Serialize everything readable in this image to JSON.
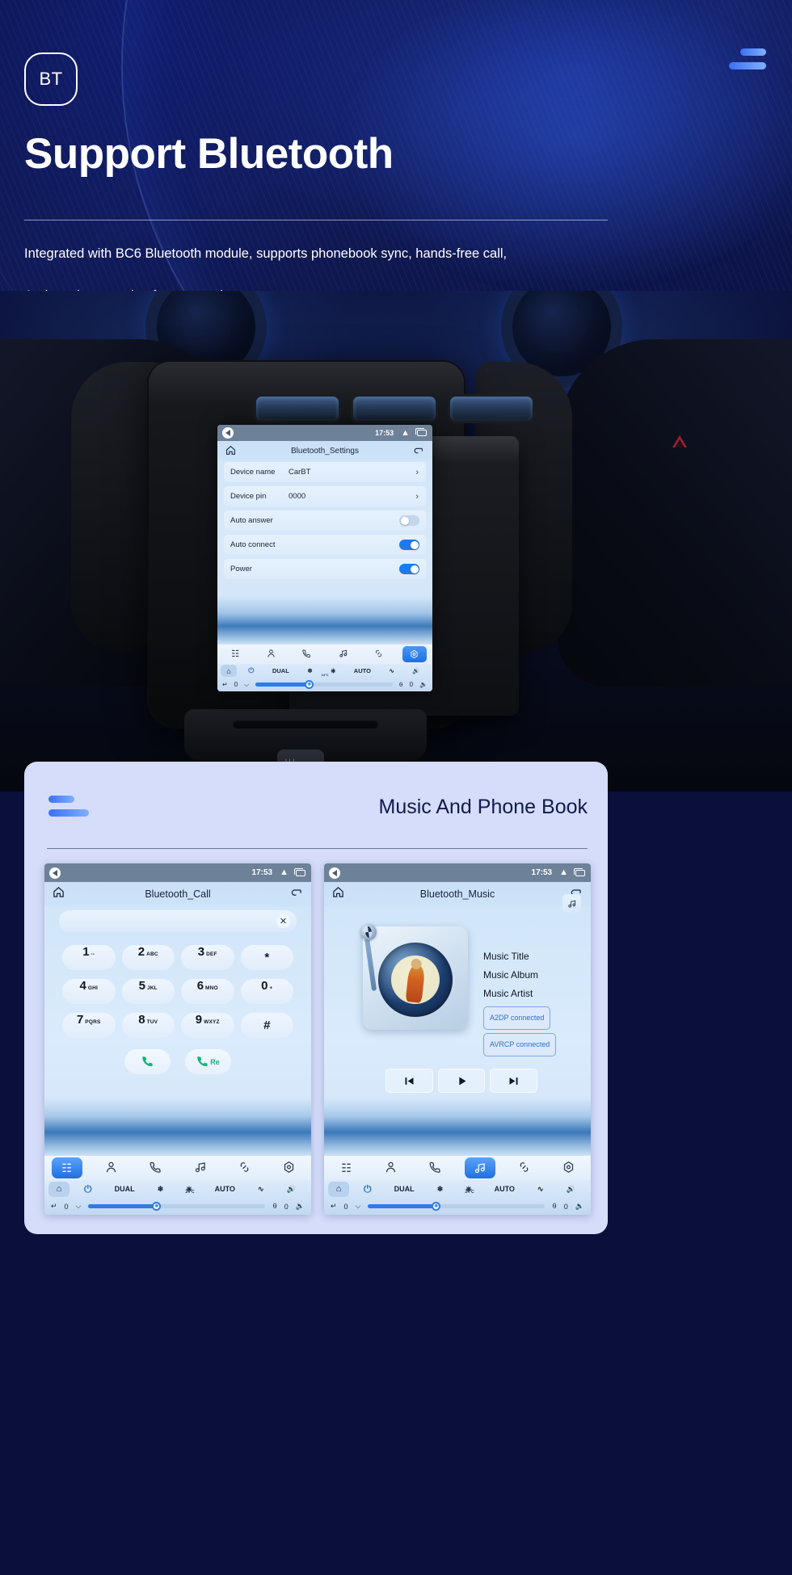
{
  "hero": {
    "badge": "BT",
    "title": "Support Bluetooth",
    "subtitle_line1": "Integrated with BC6 Bluetooth module, supports phonebook sync, hands-free call,",
    "subtitle_line2": "And music streaming from your phone.",
    "accent_color": "#3b6ff5",
    "background_color": "#0d1448"
  },
  "head_unit": {
    "statusbar": {
      "back_icon": "back-arrow-icon",
      "time": "17:53",
      "chevron_icon": "chevron-up-icon",
      "window_icon": "recent-apps-icon"
    },
    "title": "Bluetooth_Settings",
    "home_icon": "home-icon",
    "back_icon": "undo-back-icon",
    "settings_rows": [
      {
        "label": "Device name",
        "value": "CarBT",
        "control": "chevron"
      },
      {
        "label": "Device pin",
        "value": "0000",
        "control": "chevron"
      },
      {
        "label": "Auto answer",
        "value": "",
        "control": "toggle-off"
      },
      {
        "label": "Auto connect",
        "value": "",
        "control": "toggle-on"
      },
      {
        "label": "Power",
        "value": "",
        "control": "toggle-on"
      }
    ],
    "tabs": [
      {
        "icon": "apps-grid-icon",
        "active": false
      },
      {
        "icon": "contacts-person-icon",
        "active": false
      },
      {
        "icon": "phone-call-icon",
        "active": false
      },
      {
        "icon": "music-note-icon",
        "active": false
      },
      {
        "icon": "link-chain-icon",
        "active": false
      },
      {
        "icon": "settings-gear-icon",
        "active": true
      }
    ],
    "climate": {
      "home_icon": "home-icon",
      "power_icon": "power-icon",
      "dual_label": "DUAL",
      "snow_icon": "snowflake-icon",
      "defrost_icon": "defrost-icon",
      "auto_label": "AUTO",
      "recirc_icon": "recirculate-icon",
      "volume_up_icon": "volume-up-icon",
      "temperature": "24°C",
      "back_icon": "back-arrow-icon",
      "left_value": "0",
      "right_value": "0",
      "seat_icon": "seat-icon",
      "seat_heat_icon": "seat-heat-icon",
      "fan_icon": "fan-icon",
      "volume_down_icon": "volume-down-icon"
    }
  },
  "bottom_card": {
    "title": "Music And Phone Book",
    "accent_color": "#3b6ff5",
    "background_color": "#d5ddfb"
  },
  "call_screen": {
    "statusbar": {
      "time": "17:53"
    },
    "title": "Bluetooth_Call",
    "home_icon": "home-icon",
    "back_icon": "undo-back-icon",
    "search_value": "",
    "clear_icon": "close-x-icon",
    "keys": [
      {
        "num": "1",
        "sub": "--"
      },
      {
        "num": "2",
        "sub": "ABC"
      },
      {
        "num": "3",
        "sub": "DEF"
      },
      {
        "num": "*",
        "sub": ""
      },
      {
        "num": "4",
        "sub": "GHI"
      },
      {
        "num": "5",
        "sub": "JKL"
      },
      {
        "num": "6",
        "sub": "MNO"
      },
      {
        "num": "0",
        "sub": "+"
      },
      {
        "num": "7",
        "sub": "PQRS"
      },
      {
        "num": "8",
        "sub": "TUV"
      },
      {
        "num": "9",
        "sub": "WXYZ"
      },
      {
        "num": "#",
        "sub": ""
      }
    ],
    "call_button_icon": "phone-call-icon",
    "redial_label": "Re",
    "tabs": [
      {
        "icon": "apps-grid-icon",
        "active": true
      },
      {
        "icon": "contacts-person-icon",
        "active": false
      },
      {
        "icon": "phone-call-icon",
        "active": false
      },
      {
        "icon": "music-note-icon",
        "active": false
      },
      {
        "icon": "link-chain-icon",
        "active": false
      },
      {
        "icon": "settings-gear-icon",
        "active": false
      }
    ],
    "climate": {
      "dual_label": "DUAL",
      "auto_label": "AUTO",
      "temperature": "24°C",
      "left_value": "0",
      "right_value": "0"
    }
  },
  "music_screen": {
    "statusbar": {
      "time": "17:53"
    },
    "title": "Bluetooth_Music",
    "home_icon": "home-icon",
    "back_icon": "undo-back-icon",
    "note_button_icon": "music-note-icon",
    "track_title": "Music Title",
    "track_album": "Music Album",
    "track_artist": "Music Artist",
    "badges": [
      "A2DP  connected",
      "AVRCP connected"
    ],
    "controls": [
      {
        "icon": "previous-track-icon"
      },
      {
        "icon": "play-icon"
      },
      {
        "icon": "next-track-icon"
      }
    ],
    "tabs": [
      {
        "icon": "apps-grid-icon",
        "active": false
      },
      {
        "icon": "contacts-person-icon",
        "active": false
      },
      {
        "icon": "phone-call-icon",
        "active": false
      },
      {
        "icon": "music-note-icon",
        "active": true
      },
      {
        "icon": "link-chain-icon",
        "active": false
      },
      {
        "icon": "settings-gear-icon",
        "active": false
      }
    ],
    "climate": {
      "dual_label": "DUAL",
      "auto_label": "AUTO",
      "temperature": "24°C",
      "left_value": "0",
      "right_value": "0"
    }
  }
}
